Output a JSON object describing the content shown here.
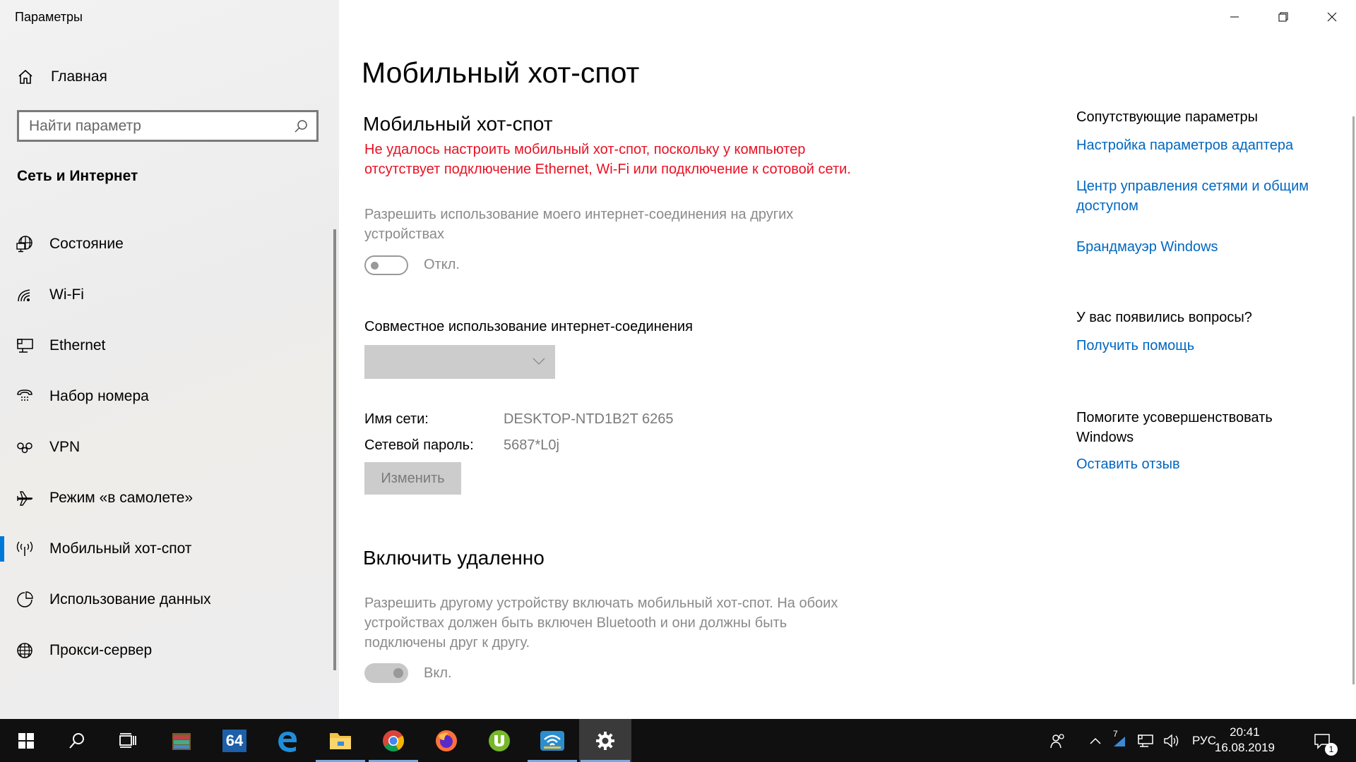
{
  "app": {
    "title": "Параметры"
  },
  "window_controls": {
    "minimize": "minimize-icon",
    "maximize": "restore-icon",
    "close": "close-icon"
  },
  "sidebar": {
    "home_label": "Главная",
    "search_placeholder": "Найти параметр",
    "section_title": "Сеть и Интернет",
    "items": [
      {
        "label": "Состояние",
        "icon": "status-globe-icon",
        "active": false
      },
      {
        "label": "Wi-Fi",
        "icon": "wifi-icon",
        "active": false
      },
      {
        "label": "Ethernet",
        "icon": "ethernet-icon",
        "active": false
      },
      {
        "label": "Набор номера",
        "icon": "dialup-phone-icon",
        "active": false
      },
      {
        "label": "VPN",
        "icon": "vpn-icon",
        "active": false
      },
      {
        "label": "Режим «в самолете»",
        "icon": "airplane-icon",
        "active": false
      },
      {
        "label": "Мобильный хот-спот",
        "icon": "hotspot-icon",
        "active": true
      },
      {
        "label": "Использование данных",
        "icon": "data-usage-icon",
        "active": false
      },
      {
        "label": "Прокси-сервер",
        "icon": "proxy-globe-icon",
        "active": false
      }
    ]
  },
  "main": {
    "page_title": "Мобильный хот-спот",
    "hotspot": {
      "heading": "Мобильный хот-спот",
      "error": "Не удалось настроить мобильный хот-спот, поскольку у компьютер отсутствует подключение Ethernet, Wi-Fi или подключение к сотовой сети.",
      "share_desc": "Разрешить использование моего интернет-соединения на других устройствах",
      "toggle_state": "Откл.",
      "toggle_on": false
    },
    "sharing": {
      "label": "Совместное использование интернет-соединения",
      "selected": ""
    },
    "network_name_label": "Имя сети:",
    "network_name_value": "DESKTOP-NTD1B2T 6265",
    "password_label": "Сетевой пароль:",
    "password_value": "5687*L0j",
    "change_button": "Изменить",
    "remote": {
      "heading": "Включить удаленно",
      "desc": "Разрешить другому устройству включать мобильный хот-спот. На обоих устройствах должен быть включен Bluetooth и они должны быть подключены друг к другу.",
      "toggle_state": "Вкл.",
      "toggle_on": true
    }
  },
  "related": {
    "heading": "Сопутствующие параметры",
    "links": [
      "Настройка параметров адаптера",
      "Центр управления сетями и общим доступом",
      "Брандмауэр Windows"
    ],
    "questions_heading": "У вас появились вопросы?",
    "help_link": "Получить помощь",
    "improve_heading": "Помогите усовершенствовать Windows",
    "feedback_link": "Оставить отзыв"
  },
  "taskbar": {
    "apps": [
      "start-icon",
      "search-icon",
      "task-view-icon",
      "winrar-icon",
      "aida64-icon",
      "edge-icon",
      "file-explorer-icon",
      "chrome-icon",
      "firefox-icon",
      "utorrent-icon",
      "wifi-app-icon",
      "settings-icon"
    ],
    "aida_label": "64",
    "language": "РУС",
    "time": "20:41",
    "date": "16.08.2019",
    "notification_count": "1",
    "tray_badge": "7"
  }
}
